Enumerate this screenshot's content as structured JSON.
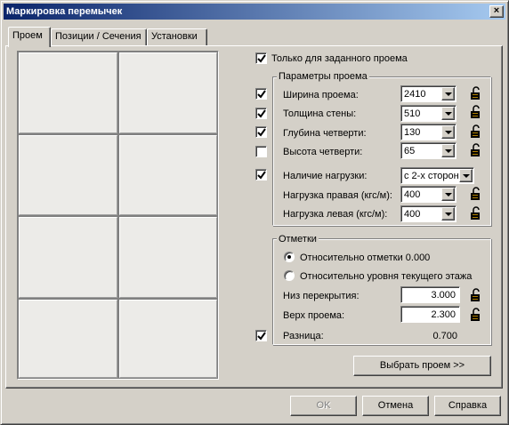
{
  "window": {
    "title": "Маркировка перемычек",
    "close_glyph": "×"
  },
  "tabs": [
    {
      "label": "Проем",
      "active": true
    },
    {
      "label": "Позиции / Сечения",
      "active": false
    },
    {
      "label": "Установки",
      "active": false
    }
  ],
  "only_opening": {
    "label": "Только для заданного проема",
    "checked": true
  },
  "params": {
    "title": "Параметры проема",
    "rows": [
      {
        "label": "Ширина проема:",
        "value": "2410",
        "checked": true,
        "lock": "lock-icon"
      },
      {
        "label": "Толщина стены:",
        "value": "510",
        "checked": true,
        "lock": "lock-icon"
      },
      {
        "label": "Глубина четверти:",
        "value": "130",
        "checked": true,
        "lock": "lock-icon"
      },
      {
        "label": "Высота четверти:",
        "value": "65",
        "checked": false,
        "lock": "lock-icon"
      }
    ],
    "load": {
      "label": "Наличие нагрузки:",
      "value": "с 2-х сторон",
      "checked": true
    },
    "load_right": {
      "label": "Нагрузка правая (кгс/м):",
      "value": "400"
    },
    "load_left": {
      "label": "Нагрузка левая (кгс/м):",
      "value": "400"
    }
  },
  "marks": {
    "title": "Отметки",
    "radio_relative_mark": {
      "label": "Относительно отметки 0.000",
      "selected": true
    },
    "radio_relative_floor": {
      "label": "Относительно уровня текущего этажа",
      "selected": false
    },
    "floor_bottom": {
      "label": "Низ перекрытия:",
      "value": "3.000"
    },
    "opening_top": {
      "label": "Верх проема:",
      "value": "2.300"
    },
    "difference": {
      "label": "Разница:",
      "value": "0.700",
      "checked": true
    }
  },
  "buttons": {
    "select_opening": "Выбрать проем >>",
    "ok": "OK",
    "cancel": "Отмена",
    "help": "Справка"
  },
  "colors": {
    "face": "#d4d0c8",
    "title_start": "#0a246a",
    "title_end": "#a6caf0"
  }
}
